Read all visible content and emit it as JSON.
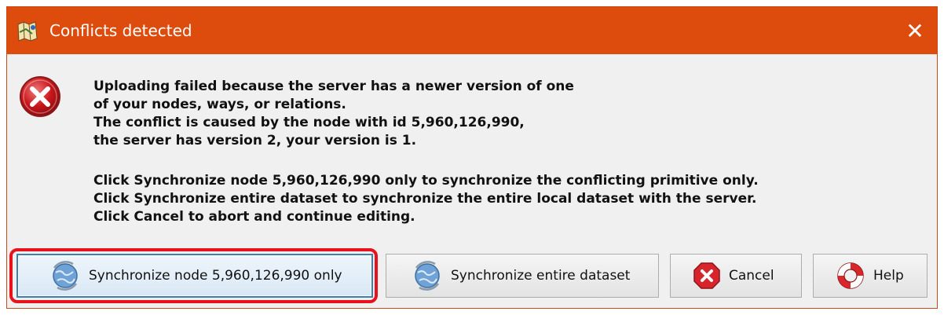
{
  "window": {
    "title": "Conflicts detected",
    "close_glyph": "✕",
    "app_icon": "josm-map-icon",
    "titlebar_color": "#dd4c0d"
  },
  "message": {
    "icon": "error-icon",
    "lines": [
      "Uploading failed because the server has a newer version of one",
      "of your nodes, ways, or relations.",
      "The conflict is caused by the node with id 5,960,126,990,",
      "the server has version 2, your version is 1.",
      "Click Synchronize node 5,960,126,990 only to synchronize the conflicting primitive only.",
      "Click Synchronize entire dataset to synchronize the entire local dataset with the server.",
      "Click Cancel to abort and continue editing."
    ]
  },
  "buttons": {
    "sync_node": {
      "label": "Synchronize node 5,960,126,990 only",
      "icon": "globe-sync-icon"
    },
    "sync_all": {
      "label": "Synchronize entire dataset",
      "icon": "globe-sync-icon"
    },
    "cancel": {
      "label": "Cancel",
      "icon": "cancel-icon"
    },
    "help": {
      "label": "Help",
      "icon": "lifebuoy-icon"
    }
  },
  "annotation": {
    "highlight_color": "#e8121c",
    "highlighted": "sync_node"
  }
}
